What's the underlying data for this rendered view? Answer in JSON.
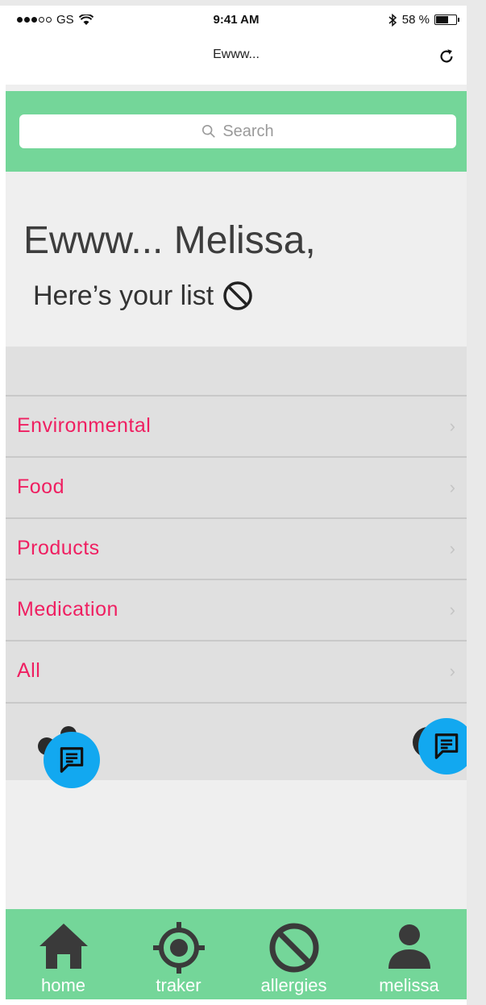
{
  "status_bar": {
    "carrier": "GS",
    "time": "9:41 AM",
    "battery": "58 %",
    "battery_level": 0.58
  },
  "browser": {
    "page_title": "Ewww...",
    "reload_icon": "reload-icon"
  },
  "search": {
    "placeholder": "Search",
    "icon": "search-icon"
  },
  "greeting": {
    "title": "Ewww... Melissa,",
    "subtitle": "Here’s your list",
    "subtitle_icon": "no-symbol-icon"
  },
  "categories": [
    {
      "label": "Environmental"
    },
    {
      "label": "Food"
    },
    {
      "label": "Products"
    },
    {
      "label": "Medication"
    },
    {
      "label": "All"
    }
  ],
  "tabs": [
    {
      "label": "home",
      "icon": "home-icon"
    },
    {
      "label": "traker",
      "icon": "crosshair-icon"
    },
    {
      "label": "allergies",
      "icon": "no-symbol-icon"
    },
    {
      "label": "melissa",
      "icon": "person-icon"
    }
  ],
  "colors": {
    "accent_green": "#74d699",
    "category_text": "#ef1f61",
    "chat_fab": "#12a8f0"
  }
}
